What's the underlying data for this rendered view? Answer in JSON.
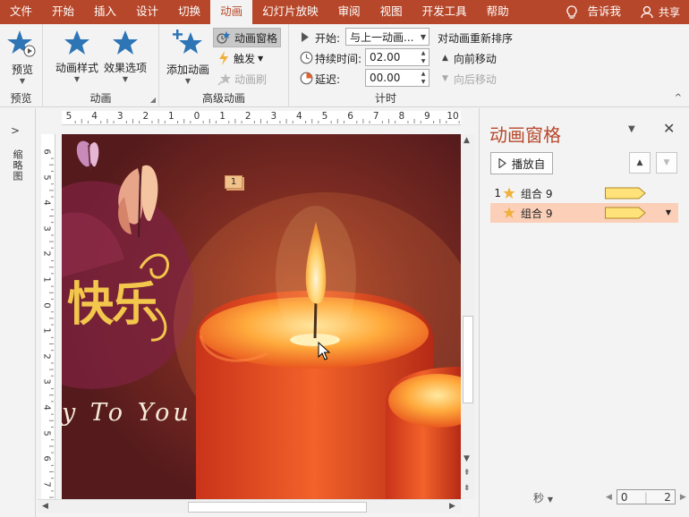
{
  "menu": {
    "tabs": [
      "文件",
      "开始",
      "插入",
      "设计",
      "切换",
      "动画",
      "幻灯片放映",
      "审阅",
      "视图",
      "开发工具",
      "帮助"
    ],
    "active_tab": "动画",
    "tell_me": "告诉我",
    "share": "共享"
  },
  "ribbon": {
    "preview": {
      "button": "预览",
      "group": "预览"
    },
    "animation": {
      "style_button": "动画样式",
      "effect_button": "效果选项",
      "group": "动画"
    },
    "advanced": {
      "add_button": "添加动画",
      "pane_button": "动画窗格",
      "trigger_button": "触发",
      "painter_button": "动画刷",
      "group": "高级动画"
    },
    "timing": {
      "start_label": "开始:",
      "start_value": "与上一动画...",
      "duration_label": "持续时间:",
      "duration_value": "02.00",
      "delay_label": "延迟:",
      "delay_value": "00.00",
      "reorder_label": "对动画重新排序",
      "move_earlier": "向前移动",
      "move_later": "向后移动",
      "group": "计时"
    }
  },
  "left_panel": {
    "label": "缩略图"
  },
  "ruler": {
    "h": [
      "5",
      "4",
      "3",
      "2",
      "1",
      "0",
      "1",
      "2",
      "3",
      "4",
      "5",
      "6",
      "7",
      "8",
      "9",
      "10"
    ],
    "v": [
      "6",
      "5",
      "4",
      "3",
      "2",
      "1",
      "0",
      "1",
      "2",
      "3",
      "4",
      "5",
      "6",
      "7"
    ]
  },
  "slide": {
    "title_text": "快乐",
    "subtitle_text": "y To You",
    "anim_marker": "1"
  },
  "pane": {
    "title": "动画窗格",
    "play_button": "播放自",
    "items": [
      {
        "index": "1",
        "name": "组合 9",
        "selected": false
      },
      {
        "index": "",
        "name": "组合 9",
        "selected": true
      }
    ],
    "time_unit": "秒",
    "timeline_start": "0",
    "timeline_end": "2"
  },
  "colors": {
    "accent": "#b7472a",
    "ribbon_bg": "#f3f3f3",
    "star_blue": "#2e75b6",
    "star_gold": "#f0b03c",
    "bar_fill": "#ffe37a",
    "selected_row": "#fbcfb8"
  }
}
